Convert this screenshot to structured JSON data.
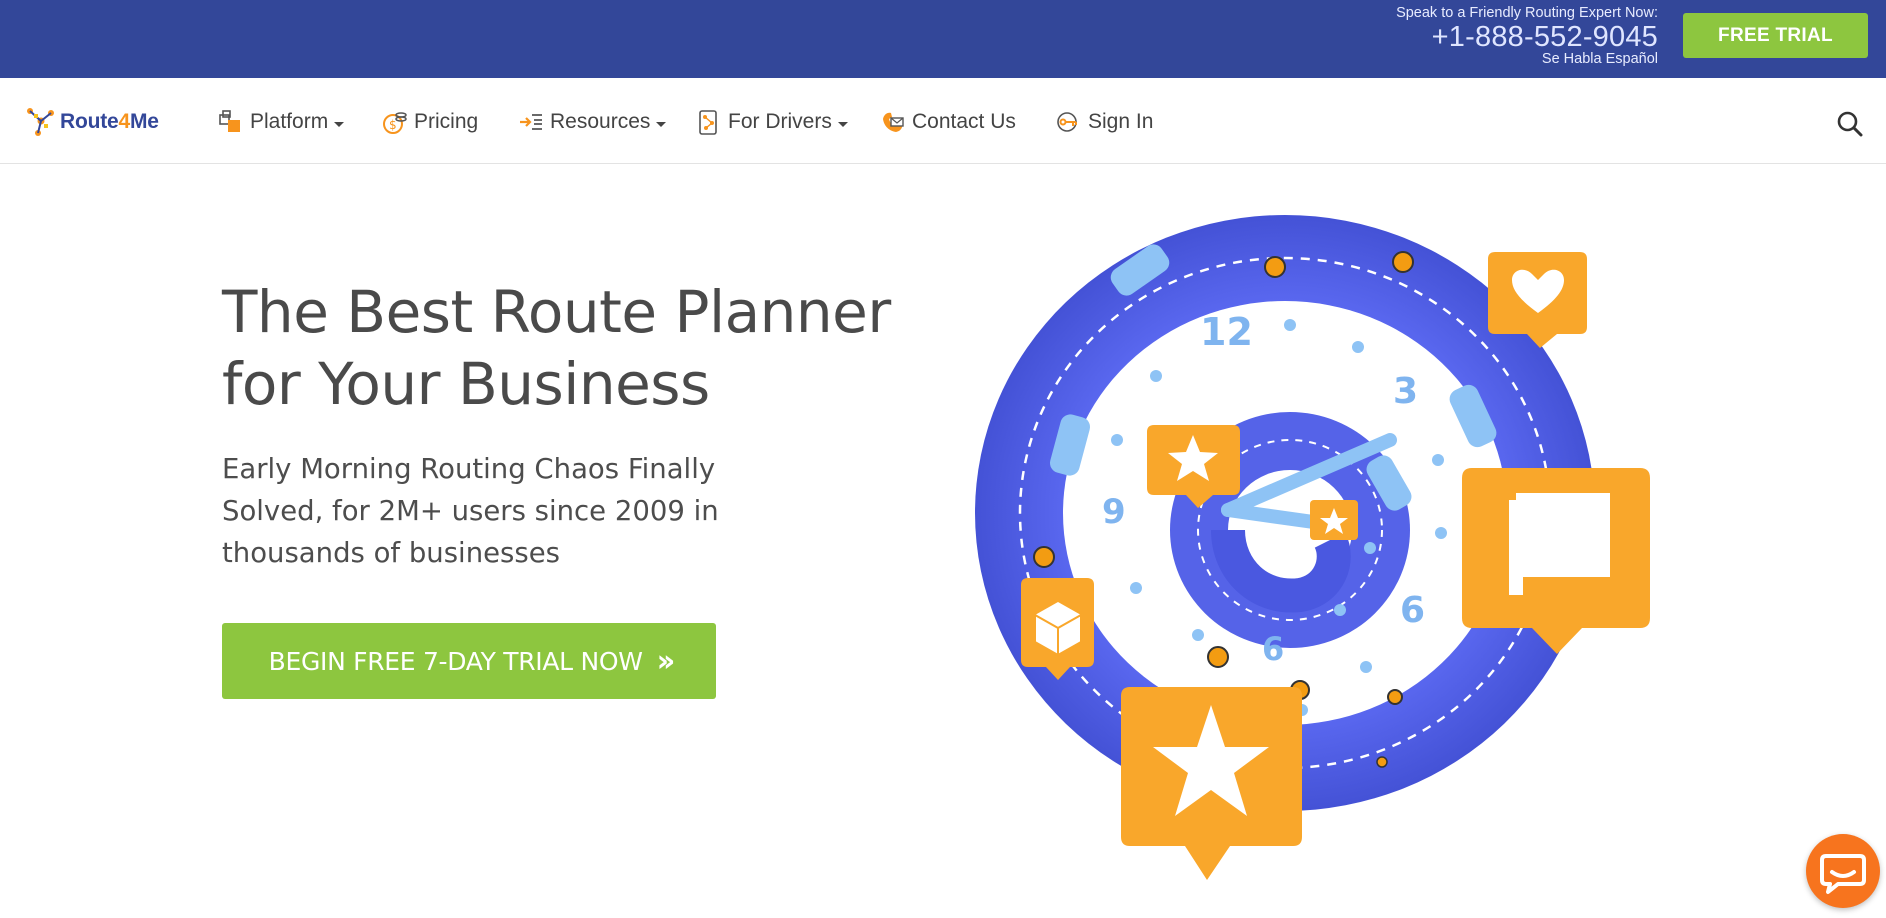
{
  "topbar": {
    "speak_line": "Speak to a Friendly Routing Expert Now:",
    "phone": "+1-888-552-9045",
    "habla": "Se Habla Español",
    "free_trial_label": "FREE TRIAL"
  },
  "logo": {
    "text_a": "Route",
    "text_b": "4",
    "text_c": "Me"
  },
  "nav": {
    "items": [
      {
        "label": "Platform",
        "icon": "boxes-icon",
        "dropdown": true
      },
      {
        "label": "Pricing",
        "icon": "coin-icon",
        "dropdown": false
      },
      {
        "label": "Resources",
        "icon": "list-arrow-icon",
        "dropdown": true
      },
      {
        "label": "For Drivers",
        "icon": "phone-route-icon",
        "dropdown": true
      },
      {
        "label": "Contact Us",
        "icon": "phone-mail-icon",
        "dropdown": false
      },
      {
        "label": "Sign In",
        "icon": "key-icon",
        "dropdown": false
      }
    ],
    "search_icon": "search-icon"
  },
  "hero": {
    "title_line1": "The Best Route Planner",
    "title_line2": "for Your Business",
    "subtitle": "Early Morning Routing Chaos Finally Solved, for 2M+ users since 2009 in thousands of businesses",
    "cta_label": "BEGIN FREE 7-DAY TRIAL NOW",
    "cta_icon": "double-chevron-right-icon"
  },
  "illustration": {
    "clock_numbers": [
      "12",
      "3",
      "6",
      "9",
      "6"
    ]
  },
  "colors": {
    "topbar": "#334799",
    "accent_green": "#8dc63f",
    "accent_orange": "#f7941d",
    "road_blue": "#5563e8"
  },
  "chat_icon": "chat-bubble-icon"
}
